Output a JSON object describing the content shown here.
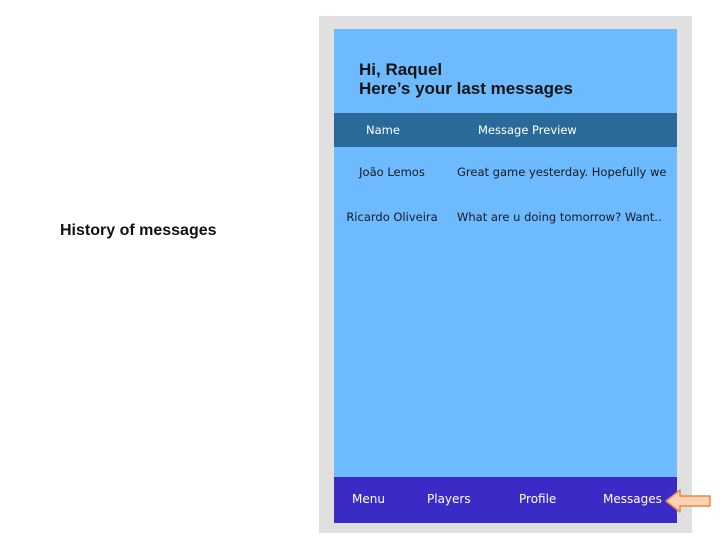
{
  "slide": {
    "caption": "History of messages"
  },
  "header": {
    "greeting_line1": "Hi, Raquel",
    "greeting_line2": "Here’s your last messages"
  },
  "table": {
    "columns": [
      "Name",
      "Message Preview"
    ],
    "rows": [
      {
        "name": "João Lemos",
        "preview": "Great game yesterday. Hopefully we.."
      },
      {
        "name": "Ricardo Oliveira",
        "preview": "What are u doing tomorrow? Want.."
      }
    ]
  },
  "bottom_nav": {
    "items": [
      "Menu",
      "Players",
      "Profile",
      "Messages"
    ],
    "active": "Messages"
  },
  "pointer": {
    "icon": "left-arrow-icon",
    "fill": "#fbd3b3",
    "stroke": "#e8884a"
  },
  "colors": {
    "screen_bg": "#6ebaff",
    "header_bar": "#2a6a99",
    "nav_bar": "#3a2bc7",
    "frame": "#e0e0e0"
  }
}
